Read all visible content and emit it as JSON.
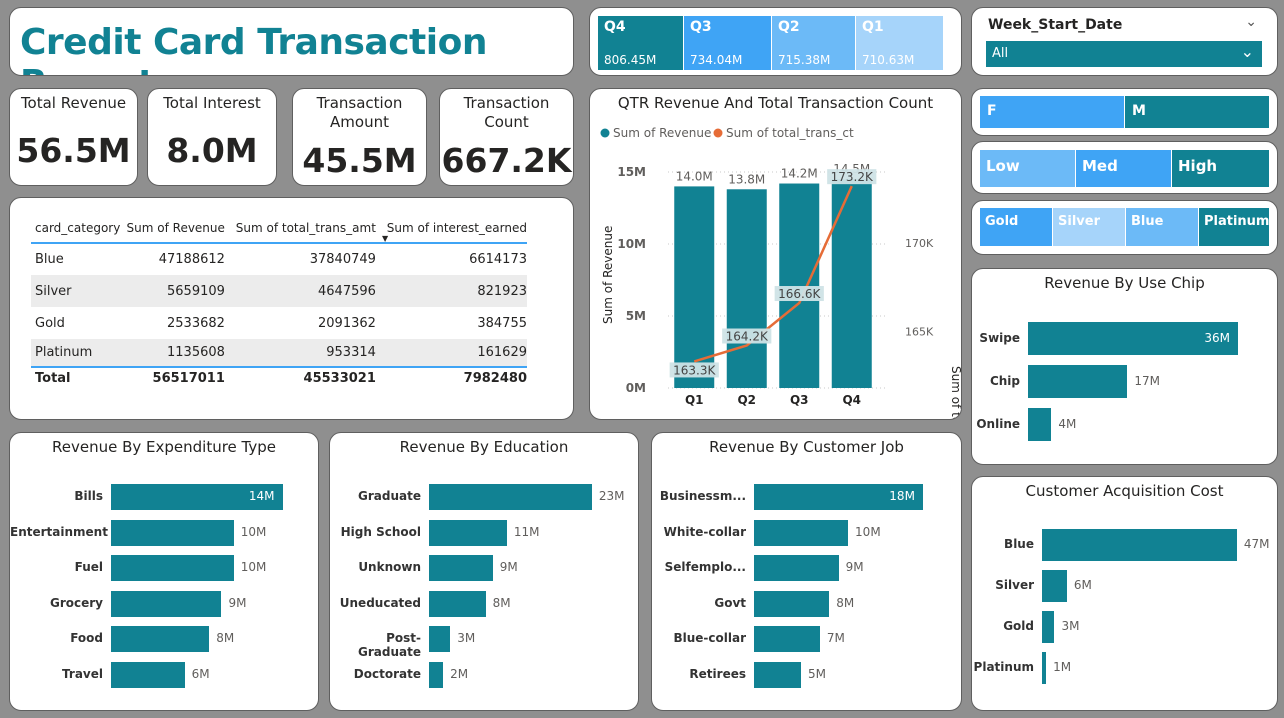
{
  "report_title": "Credit Card Transaction Report",
  "quarter_slicer": [
    {
      "label": "Q4",
      "value": "806.45M",
      "color": "#118293"
    },
    {
      "label": "Q3",
      "value": "734.04M",
      "color": "#3fa4f5"
    },
    {
      "label": "Q2",
      "value": "715.38M",
      "color": "#6cbaf7"
    },
    {
      "label": "Q1",
      "value": "710.63M",
      "color": "#a6d4fa"
    }
  ],
  "week_filter": {
    "title": "Week_Start_Date",
    "selected": "All"
  },
  "kpis": [
    {
      "label": "Total Revenue",
      "value": "56.5M"
    },
    {
      "label": "Total Interest",
      "value": "8.0M"
    },
    {
      "label": "Transaction Amount",
      "value": "45.5M"
    },
    {
      "label": "Transaction Count",
      "value": "667.2K"
    }
  ],
  "gender_slicer": [
    "F",
    "M"
  ],
  "income_slicer": [
    "Low",
    "Med",
    "High"
  ],
  "card_slicer": [
    "Gold",
    "Silver",
    "Blue",
    "Platinum"
  ],
  "table": {
    "headers": [
      "card_category",
      "Sum of Revenue",
      "Sum of total_trans_amt",
      "Sum of interest_earned"
    ],
    "rows": [
      [
        "Blue",
        "47188612",
        "37840749",
        "6614173"
      ],
      [
        "Silver",
        "5659109",
        "4647596",
        "821923"
      ],
      [
        "Gold",
        "2533682",
        "2091362",
        "384755"
      ],
      [
        "Platinum",
        "1135608",
        "953314",
        "161629"
      ]
    ],
    "total": [
      "Total",
      "56517011",
      "45533021",
      "7982480"
    ]
  },
  "chart_data": [
    {
      "type": "bar",
      "title": "QTR Revenue And Total Transaction Count",
      "legend": [
        "Sum of Revenue",
        "Sum of total_trans_ct"
      ],
      "categories": [
        "Q1",
        "Q2",
        "Q3",
        "Q4"
      ],
      "series": [
        {
          "name": "Sum of Revenue",
          "values": [
            14.0,
            13.8,
            14.2,
            14.5
          ],
          "labels": [
            "14.0M",
            "13.8M",
            "14.2M",
            "14.5M"
          ],
          "color": "#118293"
        },
        {
          "name": "Sum of total_trans_ct",
          "type": "line",
          "values": [
            163.3,
            164.2,
            166.6,
            173.2
          ],
          "labels": [
            "163.3K",
            "164.2K",
            "166.6K",
            "173.2K"
          ],
          "color": "#e66c37"
        }
      ],
      "ylabel": "Sum of Revenue",
      "y2label": "Sum of total_trans_ct",
      "yticks": [
        "0M",
        "5M",
        "10M",
        "15M"
      ],
      "y2ticks": [
        "165K",
        "170K"
      ],
      "ylim": [
        0,
        15
      ],
      "y2lim": [
        161.8,
        174
      ]
    },
    {
      "type": "bar",
      "title": "Revenue By Use Chip",
      "categories": [
        "Swipe",
        "Chip",
        "Online"
      ],
      "values": [
        36,
        17,
        4
      ],
      "labels": [
        "36M",
        "17M",
        "4M"
      ],
      "vmax": 38
    },
    {
      "type": "bar",
      "title": "Revenue By Expenditure Type",
      "categories": [
        "Bills",
        "Entertainment",
        "Fuel",
        "Grocery",
        "Food",
        "Travel"
      ],
      "values": [
        14,
        10,
        10,
        9,
        8,
        6
      ],
      "labels": [
        "14M",
        "10M",
        "10M",
        "9M",
        "8M",
        "6M"
      ],
      "vmax": 14.5
    },
    {
      "type": "bar",
      "title": "Revenue By Education",
      "categories": [
        "Graduate",
        "High School",
        "Unknown",
        "Uneducated",
        "Post-Graduate",
        "Doctorate"
      ],
      "values": [
        23,
        11,
        9,
        8,
        3,
        2
      ],
      "labels": [
        "23M",
        "11M",
        "9M",
        "8M",
        "3M",
        "2M"
      ],
      "vmax": 24
    },
    {
      "type": "bar",
      "title": "Revenue By Customer Job",
      "categories": [
        "Businessm...",
        "White-collar",
        "Selfemplo...",
        "Govt",
        "Blue-collar",
        "Retirees"
      ],
      "values": [
        18,
        10,
        9,
        8,
        7,
        5
      ],
      "labels": [
        "18M",
        "10M",
        "9M",
        "8M",
        "7M",
        "5M"
      ],
      "vmax": 18.5
    },
    {
      "type": "bar",
      "title": "Customer Acquisition Cost",
      "categories": [
        "Blue",
        "Silver",
        "Gold",
        "Platinum"
      ],
      "values": [
        47,
        6,
        3,
        1
      ],
      "labels": [
        "47M",
        "6M",
        "3M",
        "1M"
      ],
      "vmax": 48
    }
  ]
}
